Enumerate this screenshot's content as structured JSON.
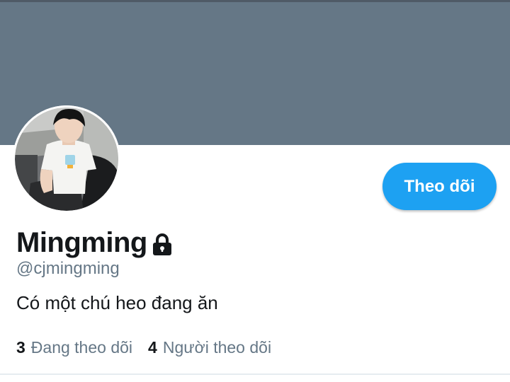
{
  "profile": {
    "display_name": "Mingming",
    "handle": "@cjmingming",
    "bio": "Có một chú heo đang ăn",
    "is_protected": true,
    "lock_icon": "lock-icon",
    "avatar_icon": "avatar-photo"
  },
  "actions": {
    "follow_label": "Theo dõi"
  },
  "stats": {
    "following": {
      "count": "3",
      "label": "Đang theo dõi"
    },
    "followers": {
      "count": "4",
      "label": "Người theo dõi"
    }
  },
  "colors": {
    "banner": "#657786",
    "accent": "#1da1f2",
    "text_primary": "#14171a",
    "text_secondary": "#657786"
  }
}
